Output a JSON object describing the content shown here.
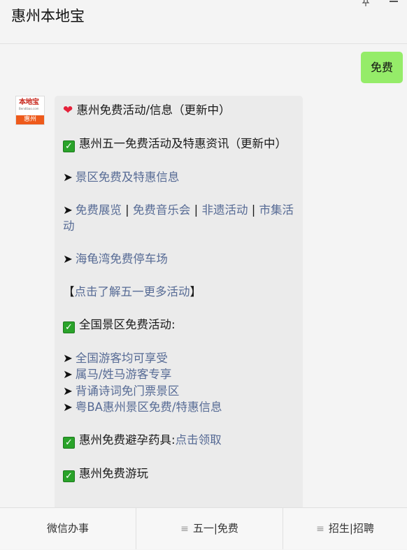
{
  "header": {
    "title": "惠州本地宝"
  },
  "chat": {
    "my_message": "免费",
    "avatar": {
      "logo": "本地宝",
      "sub": "Bendibao.com",
      "city": "惠州"
    },
    "reply": {
      "l1": "惠州免费活动/信息（更新中）",
      "l2": "惠州五一免费活动及特惠资讯（更新中）",
      "l3": "景区免费及特惠信息",
      "l4a": "免费展览",
      "sep": "|",
      "l4b": "免费音乐会",
      "l4c": "非遗活动",
      "l4d": "市集活动",
      "l5": "海龟湾免费停车场",
      "l6_open": "【",
      "l6": "点击了解五一更多活动",
      "l6_close": "】",
      "l7": "全国景区免费活动:",
      "l8": "全国游客均可享受",
      "l9": "属马/姓马游客专享",
      "l10": "背诵诗词免门票景区",
      "l11": "粤BA惠州景区免费/特惠信息",
      "l12": "惠州免费避孕药具:",
      "l12_link": "点击领取",
      "l13": "惠州免费游玩"
    }
  },
  "footer": {
    "menu": [
      "微信办事",
      "五一|免费",
      "招生|招聘"
    ]
  },
  "colors": {
    "bubble_me": "#95ec69",
    "link": "#576b95",
    "check": "#2aa32a"
  }
}
